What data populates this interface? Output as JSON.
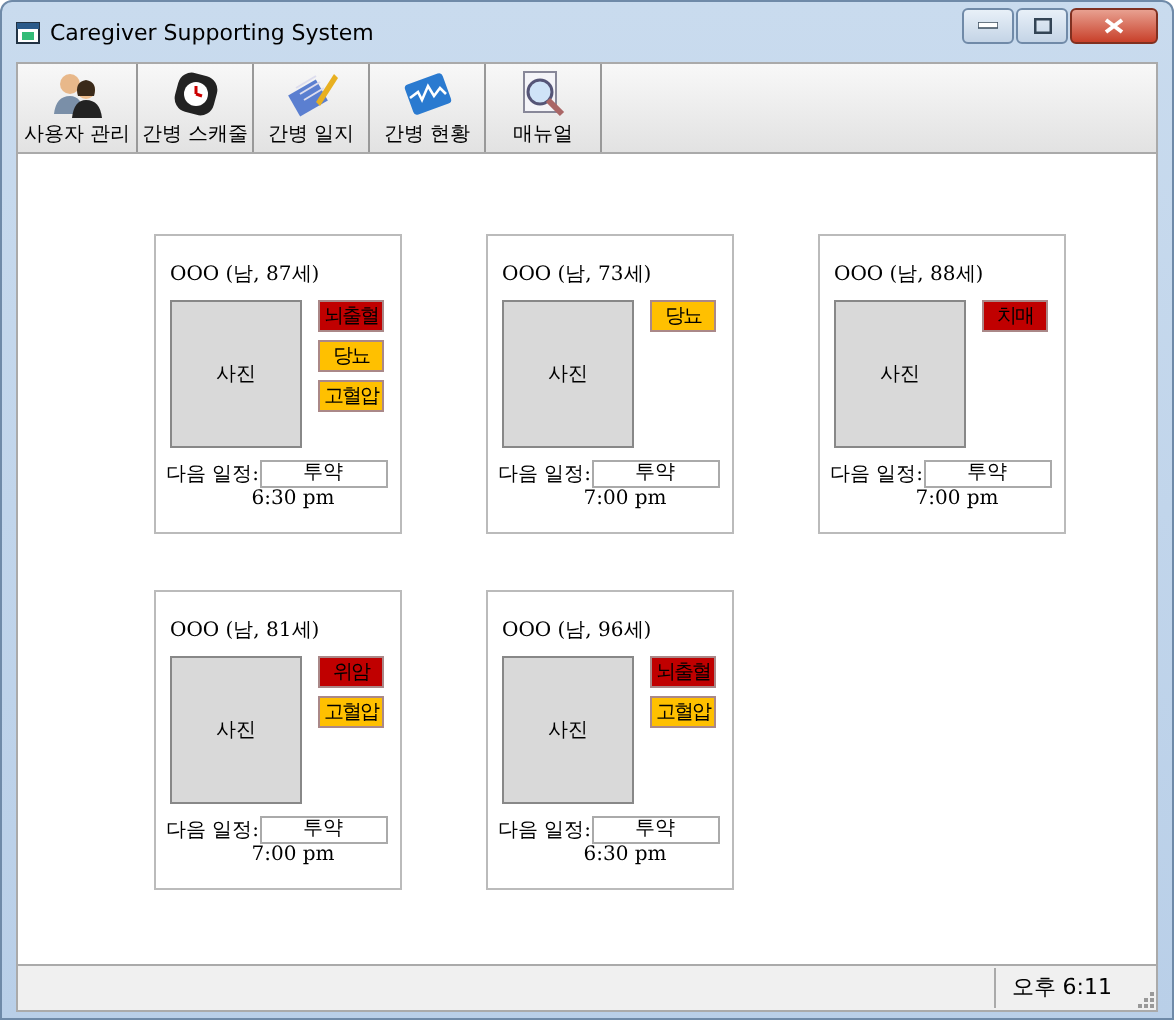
{
  "window": {
    "title": "Caregiver Supporting System"
  },
  "toolbar": [
    {
      "label": "사용자 관리",
      "kind": "users"
    },
    {
      "label": "간병 스캐줄",
      "kind": "clock"
    },
    {
      "label": "간병 일지",
      "kind": "journal"
    },
    {
      "label": "간병 현황",
      "kind": "chart"
    },
    {
      "label": "매뉴얼",
      "kind": "manual"
    }
  ],
  "patients": [
    {
      "name": "OOO (남, 87세)",
      "photo": "사진",
      "tags": [
        {
          "label": "뇌출혈",
          "color": "#c00000"
        },
        {
          "label": "당뇨",
          "color": "#ffc000"
        },
        {
          "label": "고혈압",
          "color": "#ffc000"
        }
      ],
      "schedule_label": "다음 일정:",
      "schedule": "투약",
      "time": "6:30 pm"
    },
    {
      "name": "OOO (남, 73세)",
      "photo": "사진",
      "tags": [
        {
          "label": "당뇨",
          "color": "#ffc000"
        }
      ],
      "schedule_label": "다음 일정:",
      "schedule": "투약",
      "time": "7:00 pm"
    },
    {
      "name": "OOO (남, 88세)",
      "photo": "사진",
      "tags": [
        {
          "label": "치매",
          "color": "#c00000"
        }
      ],
      "schedule_label": "다음 일정:",
      "schedule": "투약",
      "time": "7:00 pm"
    },
    {
      "name": "OOO (남, 81세)",
      "photo": "사진",
      "tags": [
        {
          "label": "위암",
          "color": "#c00000"
        },
        {
          "label": "고혈압",
          "color": "#ffc000"
        }
      ],
      "schedule_label": "다음 일정:",
      "schedule": "투약",
      "time": "7:00 pm"
    },
    {
      "name": "OOO (남, 96세)",
      "photo": "사진",
      "tags": [
        {
          "label": "뇌출혈",
          "color": "#c00000"
        },
        {
          "label": "고혈압",
          "color": "#ffc000"
        }
      ],
      "schedule_label": "다음 일정:",
      "schedule": "투약",
      "time": "6:30 pm"
    }
  ],
  "status_bar": {
    "clock": "오후 6:11"
  }
}
